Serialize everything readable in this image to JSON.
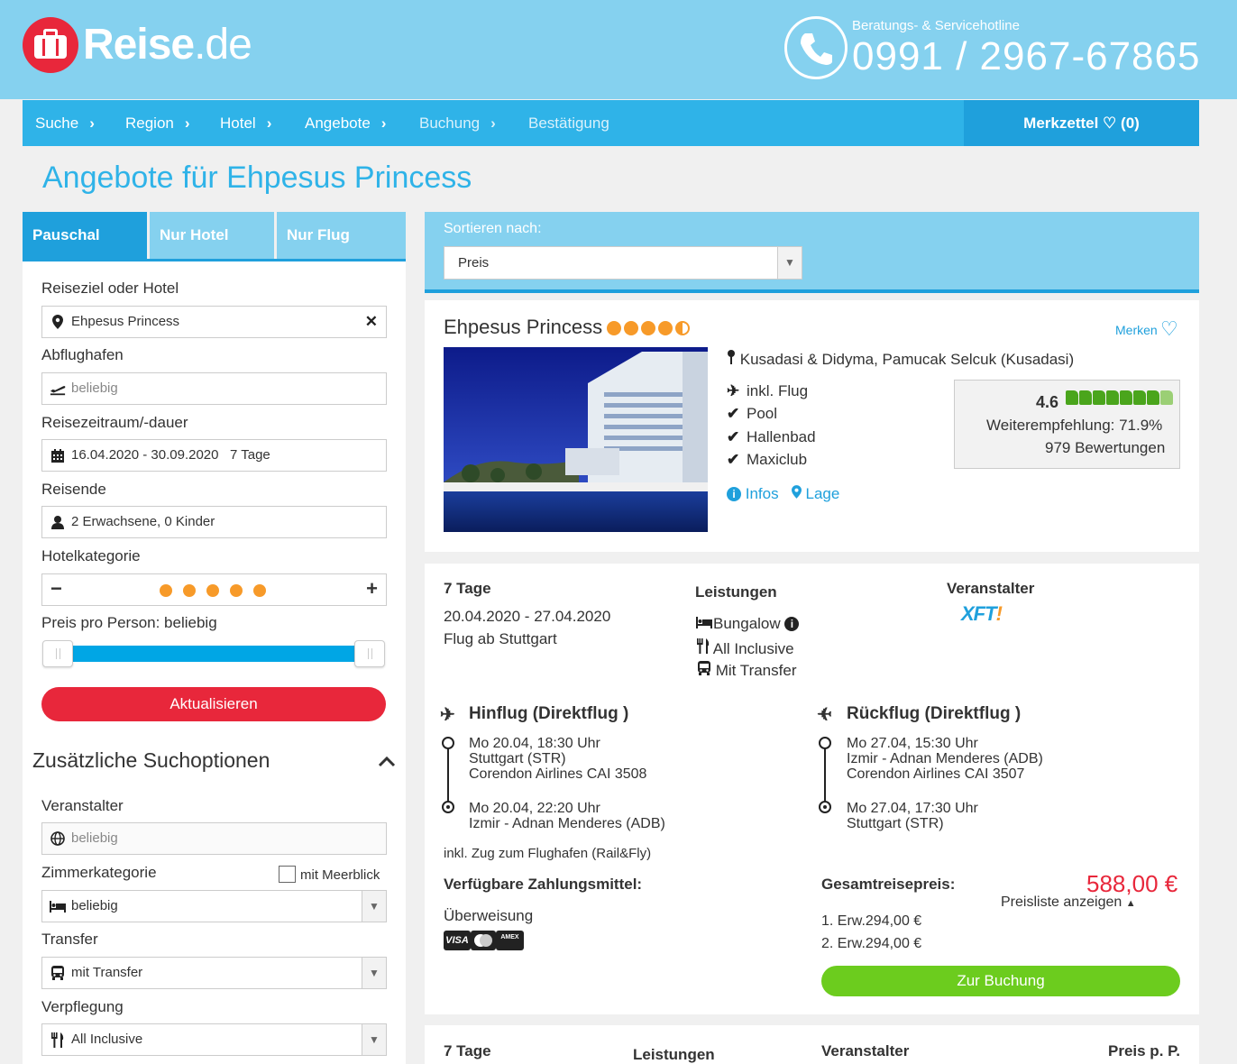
{
  "brand": {
    "logo_text_bold": "Reise",
    "logo_text_rest": ".de"
  },
  "hotline": {
    "label": "Beratungs- & Servicehotline",
    "number": "0991 / 2967-67865"
  },
  "nav": {
    "items": [
      {
        "label": "Suche"
      },
      {
        "label": "Region"
      },
      {
        "label": "Hotel"
      },
      {
        "label": "Angebote"
      },
      {
        "label": "Buchung"
      },
      {
        "label": "Bestätigung"
      }
    ],
    "merkzettel": "Merkzettel",
    "merkzettel_count": "(0)"
  },
  "page_title": "Angebote für Ehpesus Princess",
  "tabs": [
    "Pauschal",
    "Nur Hotel",
    "Nur Flug"
  ],
  "search": {
    "destination_label": "Reiseziel oder Hotel",
    "destination_value": "Ehpesus Princess",
    "airport_label": "Abflughafen",
    "airport_placeholder": "beliebig",
    "period_label": "Reisezeitraum/-dauer",
    "period_value": "16.04.2020 - 30.09.2020",
    "duration_value": "7 Tage",
    "travellers_label": "Reisende",
    "travellers_value": "2 Erwachsene, 0 Kinder",
    "category_label": "Hotelkategorie",
    "category_stars": 5,
    "price_label": "Preis pro Person: beliebig",
    "price_range_min_fraction": 0.0,
    "price_range_max_fraction": 1.0,
    "update_button": "Aktualisieren"
  },
  "extra": {
    "title": "Zusätzliche Suchoptionen",
    "operator_label": "Veranstalter",
    "operator_placeholder": "beliebig",
    "room_label": "Zimmerkategorie",
    "seaview_label": "mit Meerblick",
    "room_value": "beliebig",
    "transfer_label": "Transfer",
    "transfer_value": "mit Transfer",
    "board_label": "Verpflegung",
    "board_value": "All Inclusive"
  },
  "sort": {
    "label": "Sortieren nach:",
    "value": "Preis"
  },
  "hotel": {
    "name": "Ehpesus Princess",
    "stars": 4.5,
    "merken": "Merken",
    "location": "Kusadasi & Didyma, Pamucak Selcuk (Kusadasi)",
    "features": [
      "inkl. Flug",
      "Pool",
      "Hallenbad",
      "Maxiclub"
    ],
    "link_infos": "Infos",
    "link_lage": "Lage",
    "rating_score": "4.6",
    "rating_recommendation": "Weiterempfehlung: 71.9%",
    "rating_count": "979 Bewertungen"
  },
  "offer": {
    "duration": "7 Tage",
    "dates": "20.04.2020 - 27.04.2020",
    "departure": "Flug ab Stuttgart",
    "services_label": "Leistungen",
    "services": [
      "Bungalow",
      "All Inclusive",
      "Mit Transfer"
    ],
    "operator_label": "Veranstalter",
    "operator_logo_a": "XFT",
    "operator_logo_b": "!",
    "outbound": {
      "title": "Hinflug (Direktflug )",
      "dep_time": "Mo 20.04, 18:30 Uhr",
      "dep_airport": "Stuttgart (STR)",
      "airline": "Corendon Airlines CAI 3508",
      "arr_time": "Mo 20.04, 22:20 Uhr",
      "arr_airport": "Izmir - Adnan Menderes (ADB)"
    },
    "inbound": {
      "title": "Rückflug (Direktflug )",
      "dep_time": "Mo 27.04, 15:30 Uhr",
      "dep_airport": "Izmir - Adnan Menderes (ADB)",
      "airline": "Corendon Airlines CAI 3507",
      "arr_time": "Mo 27.04, 17:30 Uhr",
      "arr_airport": "Stuttgart (STR)"
    },
    "rail_fly": "inkl. Zug zum Flughafen (Rail&Fly)",
    "payment_label": "Verfügbare Zahlungsmittel:",
    "payment_method": "Überweisung",
    "payment_badges": [
      "VISA",
      "MC",
      "AMEX"
    ],
    "total_label": "Gesamtreisepreis:",
    "total_price": "588,00 €",
    "pricelist": "Preisliste anzeigen",
    "persons": [
      "1. Erw.294,00 €",
      "2. Erw.294,00 €"
    ],
    "book_button": "Zur Buchung"
  },
  "offer2": {
    "duration": "7 Tage",
    "services_label": "Leistungen",
    "operator_label": "Veranstalter",
    "price_label": "Preis p. P."
  }
}
